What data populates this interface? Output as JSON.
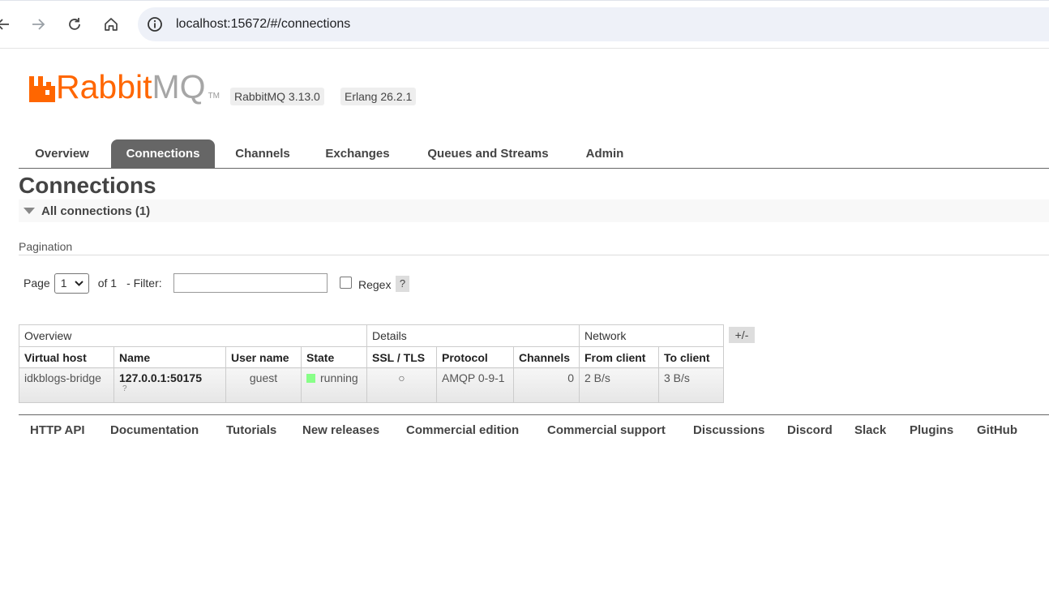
{
  "browser": {
    "url": "localhost:15672/#/connections",
    "back_icon": "arrow-left-icon",
    "forward_icon": "arrow-right-icon",
    "reload_icon": "reload-icon",
    "home_icon": "home-icon",
    "info_icon": "info-icon"
  },
  "header": {
    "logo_rabbit": "Rabbit",
    "logo_mq": "MQ",
    "logo_tm": "TM",
    "version": "RabbitMQ 3.13.0",
    "erlang": "Erlang 26.2.1",
    "brand_color": "#ff6600"
  },
  "tabs": [
    {
      "label": "Overview",
      "active": false
    },
    {
      "label": "Connections",
      "active": true
    },
    {
      "label": "Channels",
      "active": false
    },
    {
      "label": "Exchanges",
      "active": false
    },
    {
      "label": "Queues and Streams",
      "active": false
    },
    {
      "label": "Admin",
      "active": false
    }
  ],
  "page_title": "Connections",
  "section": {
    "label": "All connections (1)"
  },
  "pagination": {
    "label": "Pagination",
    "page_label": "Page",
    "page_value": "1",
    "of_text": "of 1",
    "filter_label": "- Filter:",
    "filter_value": "",
    "regex_label": "Regex",
    "help": "?"
  },
  "table": {
    "groups": [
      "Overview",
      "Details",
      "Network"
    ],
    "columns": [
      "Virtual host",
      "Name",
      "User name",
      "State",
      "SSL / TLS",
      "Protocol",
      "Channels",
      "From client",
      "To client"
    ],
    "rows": [
      {
        "virtual_host": "idkblogs-bridge",
        "name": "127.0.0.1:50175",
        "name_hint": "?",
        "user_name": "guest",
        "state": "running",
        "ssl_tls": "○",
        "protocol": "AMQP 0-9-1",
        "channels": "0",
        "from_client": "2 B/s",
        "to_client": "3 B/s"
      }
    ],
    "toggle_columns": "+/-",
    "running_color": "#88ff88"
  },
  "footer": [
    "HTTP API",
    "Documentation",
    "Tutorials",
    "New releases",
    "Commercial edition",
    "Commercial support",
    "Discussions",
    "Discord",
    "Slack",
    "Plugins",
    "GitHub"
  ]
}
